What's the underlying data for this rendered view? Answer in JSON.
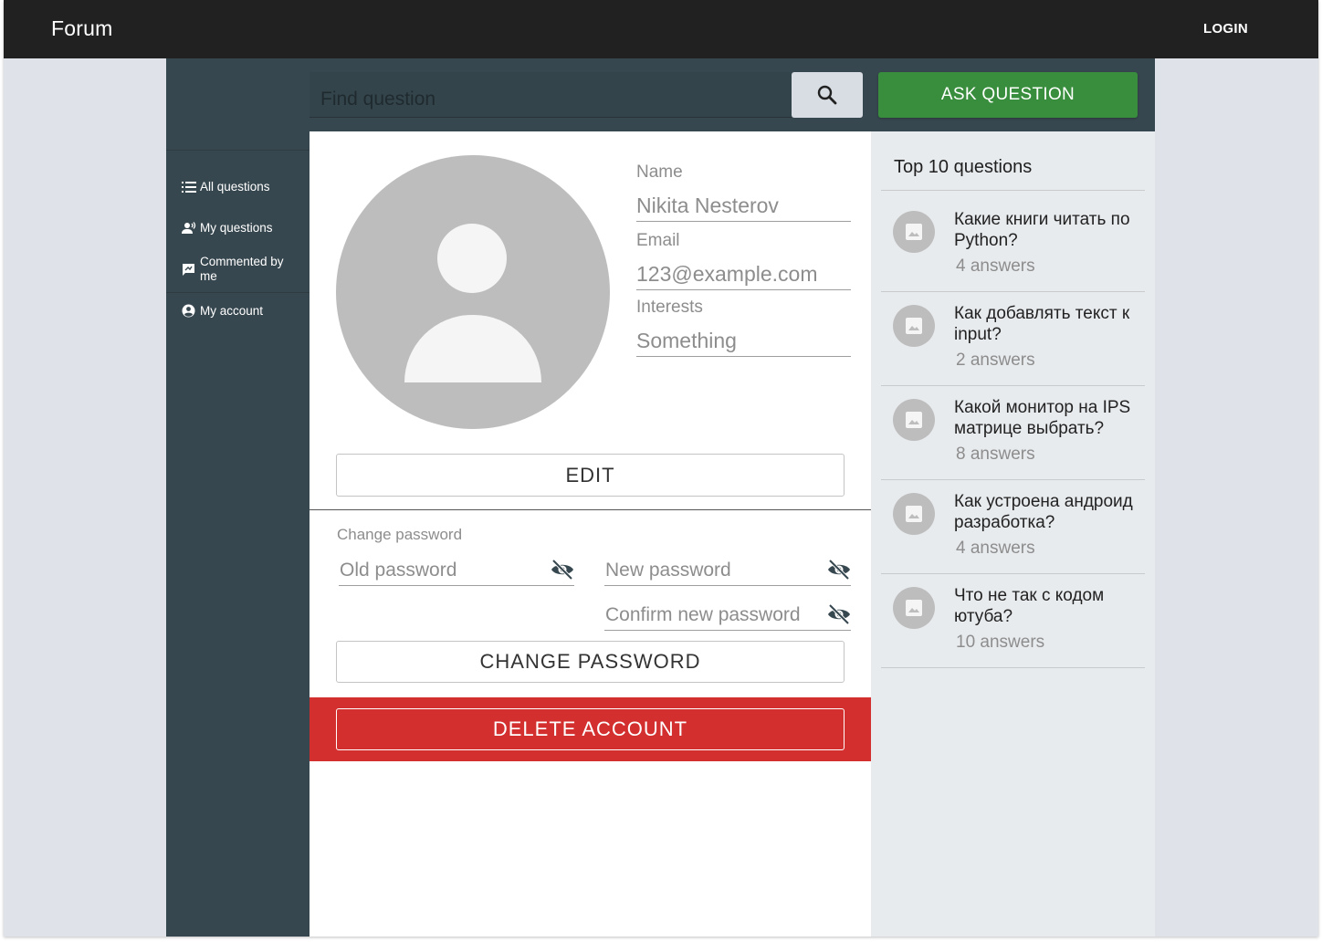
{
  "header": {
    "brand": "Forum",
    "login_label": "LOGIN"
  },
  "search": {
    "placeholder": "Find question",
    "ask_label": "ASK QUESTION"
  },
  "sidebar": {
    "items": [
      {
        "label": "All questions",
        "icon": "list-icon"
      },
      {
        "label": "My questions",
        "icon": "person-voice-icon"
      },
      {
        "label": "Commented by me",
        "icon": "comment-icon"
      },
      {
        "label": "My account",
        "icon": "account-circle-icon"
      }
    ]
  },
  "profile": {
    "name_label": "Name",
    "name_value": "Nikita Nesterov",
    "email_label": "Email",
    "email_value": "123@example.com",
    "interests_label": "Interests",
    "interests_value": "Something",
    "edit_label": "EDIT"
  },
  "password": {
    "title": "Change password",
    "old_placeholder": "Old password",
    "new_placeholder": "New password",
    "confirm_placeholder": "Confirm new password",
    "change_label": "CHANGE PASSWORD"
  },
  "danger": {
    "delete_label": "DELETE ACCOUNT"
  },
  "top": {
    "title": "Top 10 questions",
    "questions": [
      {
        "title": "Какие книги читать по Python?",
        "answers": "4 answers"
      },
      {
        "title": "Как добавлять текст к input?",
        "answers": "2 answers"
      },
      {
        "title": "Какой монитор на IPS матрице выбрать?",
        "answers": "8 answers"
      },
      {
        "title": "Как устроена андроид разработка?",
        "answers": "4 answers"
      },
      {
        "title": "Что не так с кодом ютуба?",
        "answers": "10 answers"
      }
    ]
  },
  "colors": {
    "topbar": "#212121",
    "sidebar": "#37474f",
    "ask": "#388e3c",
    "danger": "#d32f2f"
  }
}
